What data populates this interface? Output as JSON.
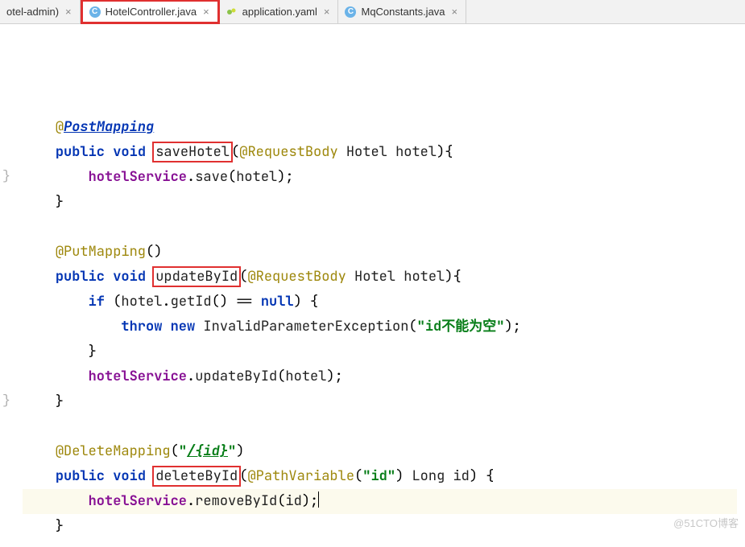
{
  "tabs": [
    {
      "label": "otel-admin)",
      "iconType": "none"
    },
    {
      "label": "HotelController.java",
      "iconType": "java",
      "iconLetter": "C",
      "highlighted": true
    },
    {
      "label": "application.yaml",
      "iconType": "yaml"
    },
    {
      "label": "MqConstants.java",
      "iconType": "java",
      "iconLetter": "C"
    }
  ],
  "close_glyph": "×",
  "gutter": {
    "collapse1": "}",
    "collapse2": "}"
  },
  "code": {
    "ann_post": "@",
    "ann_post_name": "PostMapping",
    "kw_public": "public",
    "kw_void": "void",
    "m_save": "saveHotel",
    "p_rb": "@RequestBody",
    "t_hotel": "Hotel",
    "v_hotel": "hotel",
    "f_svc": "hotelService",
    "m_svc_save": "save",
    "ann_put": "@PutMapping",
    "m_update": "updateById",
    "kw_if": "if",
    "m_getId": "getId",
    "kw_null": "null",
    "kw_throw": "throw",
    "kw_new": "new",
    "t_ipe": "InvalidParameterException",
    "str_err": "\"id不能为空\"",
    "m_svc_update": "updateById",
    "ann_del": "@DeleteMapping",
    "str_path_q1": "\"",
    "str_path_body": "/{id}",
    "str_path_q2": "\"",
    "m_delete": "deleteById",
    "p_pv": "@PathVariable",
    "str_id": "\"id\"",
    "t_long": "Long",
    "v_id": "id",
    "m_svc_remove": "removeById"
  },
  "watermark": "@51CTO博客"
}
